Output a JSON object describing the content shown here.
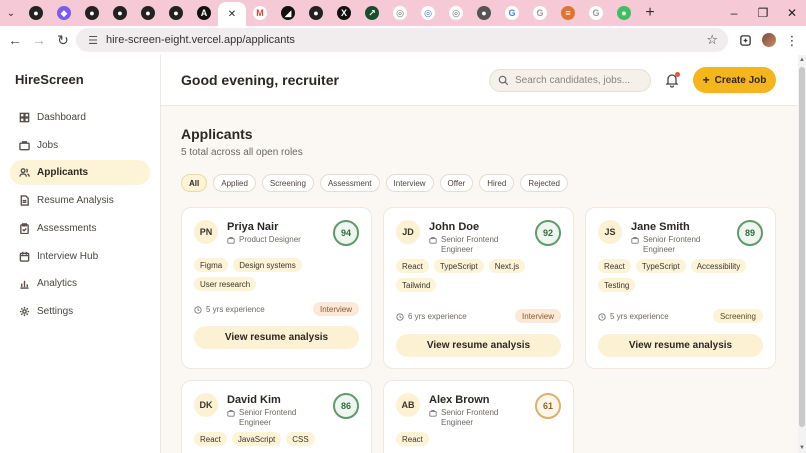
{
  "browser": {
    "url": "hire-screen-eight.vercel.app/applicants",
    "tabs": [
      {
        "icon": "github-icon",
        "color": "#222222"
      },
      {
        "icon": "drop-icon",
        "color": "#7a5cf0"
      },
      {
        "icon": "github-icon",
        "color": "#222222"
      },
      {
        "icon": "github-icon",
        "color": "#222222"
      },
      {
        "icon": "github-icon",
        "color": "#222222"
      },
      {
        "icon": "github-icon",
        "color": "#222222"
      },
      {
        "icon": "a-icon",
        "color": "#111111"
      },
      {
        "icon": "close-icon",
        "color": "#222222",
        "active": true
      },
      {
        "icon": "gmail-icon",
        "color": "#d44638"
      },
      {
        "icon": "bolt-icon",
        "color": "#111111"
      },
      {
        "icon": "github-icon",
        "color": "#222222"
      },
      {
        "icon": "x-icon",
        "color": "#111111"
      },
      {
        "icon": "chart-icon",
        "color": "#1a4d2e"
      },
      {
        "icon": "globe-icon",
        "color": "#666666"
      },
      {
        "icon": "ring-icon",
        "color": "#2f6fe0"
      },
      {
        "icon": "globe-icon",
        "color": "#666666"
      },
      {
        "icon": "circle-icon",
        "color": "#555555"
      },
      {
        "icon": "google-icon",
        "color": "#4285f4"
      },
      {
        "icon": "google-icon",
        "color": "#999999"
      },
      {
        "icon": "slides-icon",
        "color": "#e0742c"
      },
      {
        "icon": "google-icon",
        "color": "#999999"
      },
      {
        "icon": "green-dot-icon",
        "color": "#3fbf5f"
      }
    ]
  },
  "app": {
    "brand": "HireScreen",
    "nav": [
      {
        "label": "Dashboard",
        "icon": "dashboard-icon",
        "active": false
      },
      {
        "label": "Jobs",
        "icon": "briefcase-icon",
        "active": false
      },
      {
        "label": "Applicants",
        "icon": "users-icon",
        "active": true
      },
      {
        "label": "Resume Analysis",
        "icon": "document-icon",
        "active": false
      },
      {
        "label": "Assessments",
        "icon": "clipboard-icon",
        "active": false
      },
      {
        "label": "Interview Hub",
        "icon": "calendar-icon",
        "active": false
      },
      {
        "label": "Analytics",
        "icon": "bar-chart-icon",
        "active": false
      },
      {
        "label": "Settings",
        "icon": "gear-icon",
        "active": false
      }
    ],
    "greeting": "Good evening, recruiter",
    "search_placeholder": "Search candidates, jobs...",
    "create_job_label": "Create Job"
  },
  "page": {
    "title": "Applicants",
    "subtitle": "5 total across all open roles",
    "filters": [
      {
        "label": "All",
        "active": true
      },
      {
        "label": "Applied"
      },
      {
        "label": "Screening"
      },
      {
        "label": "Assessment"
      },
      {
        "label": "Interview"
      },
      {
        "label": "Offer"
      },
      {
        "label": "Hired"
      },
      {
        "label": "Rejected"
      }
    ],
    "view_button_label": "View resume analysis",
    "applicants": [
      {
        "initials": "PN",
        "name": "Priya Nair",
        "role": "Product Designer",
        "score": "94",
        "tags": [
          "Figma",
          "Design systems",
          "User research"
        ],
        "experience": "5 yrs experience",
        "status": "Interview"
      },
      {
        "initials": "JD",
        "name": "John Doe",
        "role": "Senior Frontend Engineer",
        "score": "92",
        "tags": [
          "React",
          "TypeScript",
          "Next.js",
          "Tailwind"
        ],
        "experience": "6 yrs experience",
        "status": "Interview"
      },
      {
        "initials": "JS",
        "name": "Jane Smith",
        "role": "Senior Frontend Engineer",
        "score": "89",
        "tags": [
          "React",
          "TypeScript",
          "Accessibility",
          "Testing"
        ],
        "experience": "5 yrs experience",
        "status": "Screening"
      },
      {
        "initials": "DK",
        "name": "David Kim",
        "role": "Senior Frontend Engineer",
        "score": "86",
        "tags": [
          "React",
          "JavaScript",
          "CSS"
        ]
      },
      {
        "initials": "AB",
        "name": "Alex Brown",
        "role": "Senior Frontend Engineer",
        "score": "61",
        "tags": [
          "React"
        ]
      }
    ]
  }
}
